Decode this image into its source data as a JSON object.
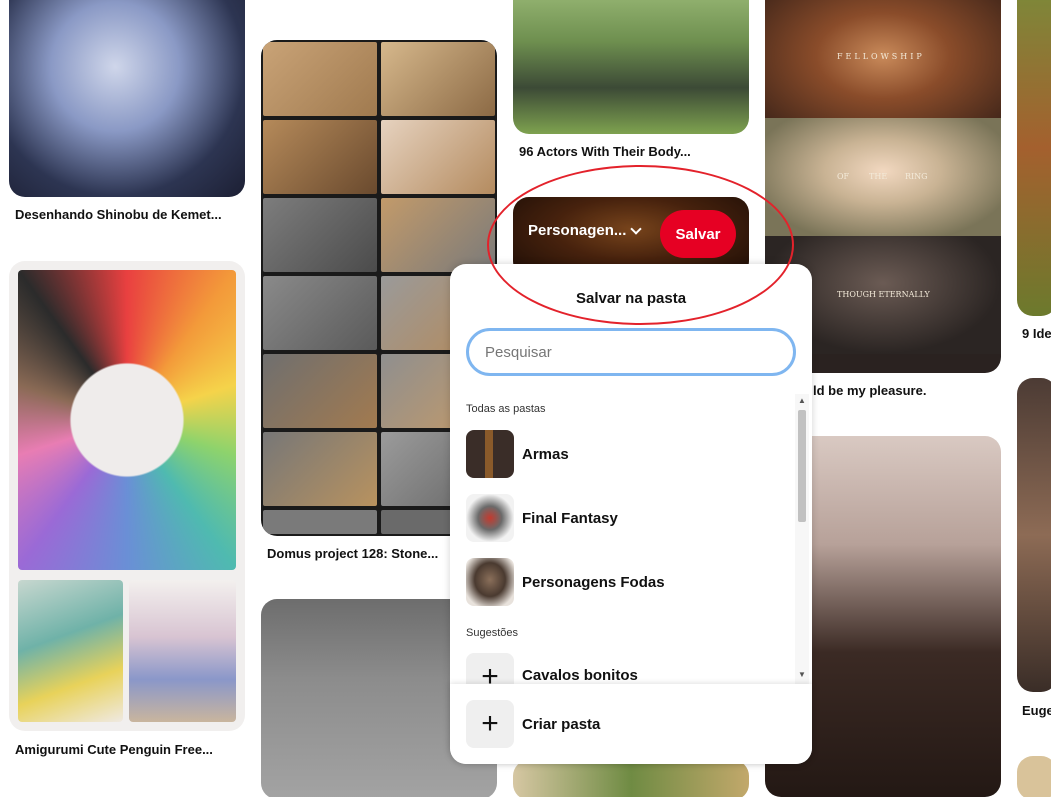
{
  "pins": {
    "shinobu_title": "Desenhando Shinobu de Kemet...",
    "amigurumi_title": "Amigurumi Cute Penguin Free...",
    "domus_title": "Domus project 128: Stone...",
    "actors_title": "96 Actors With Their Body...",
    "lotr_title": "ld be my pleasure.",
    "right1_title": "9 Ide",
    "right2_title": "Euge",
    "lotr_caption_top": "FELLOWSHIP",
    "lotr_caption_mid_1": "OF",
    "lotr_caption_mid_2": "THE",
    "lotr_caption_mid_3": "RING",
    "lotr_caption_bottom": "THOUGH ETERNALLY"
  },
  "hover": {
    "board_selector": "Personagen...",
    "save_button": "Salvar"
  },
  "popup": {
    "title": "Salvar na pasta",
    "search_placeholder": "Pesquisar",
    "all_boards_label": "Todas as pastas",
    "boards": [
      {
        "name": "Armas",
        "icon": "sword-thumbnail"
      },
      {
        "name": "Final Fantasy",
        "icon": "dragon-art-thumbnail"
      },
      {
        "name": "Personagens Fodas",
        "icon": "character-art-thumbnail"
      }
    ],
    "suggestions_label": "Sugestões",
    "suggestions": [
      {
        "name": "Cavalos bonitos",
        "icon": "plus-icon"
      }
    ],
    "create_board": "Criar pasta"
  },
  "colors": {
    "save_red": "#e60023",
    "search_focus_border": "#7fb6f0",
    "annotation_red": "#e3222b"
  }
}
